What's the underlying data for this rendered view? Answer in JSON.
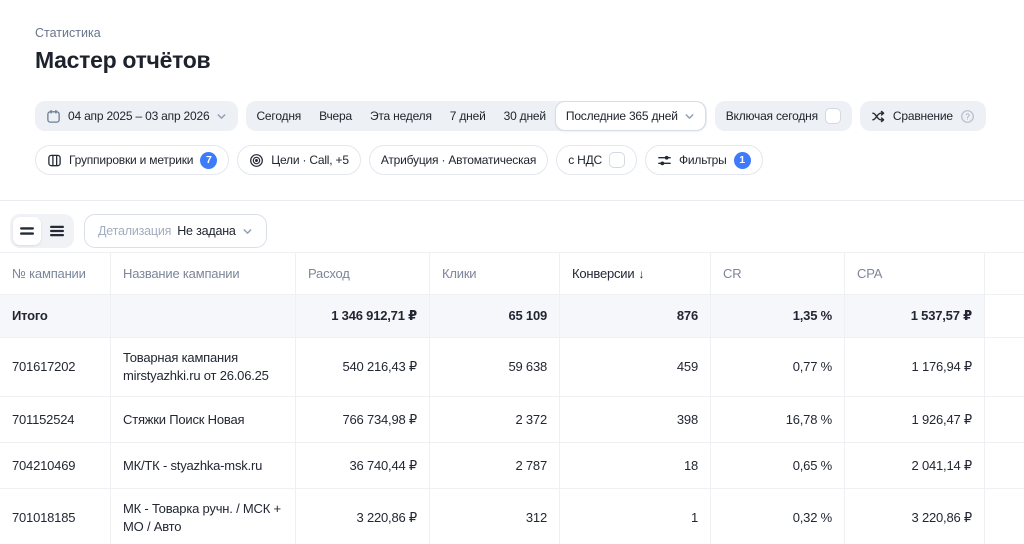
{
  "page": {
    "breadcrumb": "Статистика",
    "title": "Мастер отчётов"
  },
  "filters": {
    "date_range": "04 апр 2025 – 03 апр 2026",
    "quick_ranges": [
      "Сегодня",
      "Вчера",
      "Эта неделя",
      "7 дней",
      "30 дней"
    ],
    "selected_range": "Последние 365 дней",
    "include_today_label": "Включая сегодня",
    "comparison_label": "Сравнение",
    "groupings_label": "Группировки и метрики",
    "groupings_badge": "7",
    "goals_label": "Цели · Call, +5",
    "attribution_label": "Атрибуция · Автоматическая",
    "vat_label": "с НДС",
    "filters_label": "Фильтры",
    "filters_badge": "1"
  },
  "toolbar": {
    "detalization_label": "Детализация",
    "detalization_value": "Не задана"
  },
  "table": {
    "columns": [
      "№ кампании",
      "Название кампании",
      "Расход",
      "Клики",
      "Конверсии",
      "CR",
      "CPA"
    ],
    "sort": {
      "column": "Конверсии",
      "direction": "desc"
    },
    "totals": {
      "label": "Итого",
      "cost": "1 346 912,71 ₽",
      "clicks": "65 109",
      "conversions": "876",
      "cr": "1,35 %",
      "cpa": "1 537,57 ₽"
    },
    "rows": [
      {
        "id": "701617202",
        "name": "Товарная кампания mirstyazhki.ru от 26.06.25",
        "cost": "540 216,43 ₽",
        "clicks": "59 638",
        "conversions": "459",
        "cr": "0,77 %",
        "cpa": "1 176,94 ₽"
      },
      {
        "id": "701152524",
        "name": "Стяжки Поиск Новая",
        "cost": "766 734,98 ₽",
        "clicks": "2 372",
        "conversions": "398",
        "cr": "16,78 %",
        "cpa": "1 926,47 ₽"
      },
      {
        "id": "704210469",
        "name": "МК/ТК - styazhka-msk.ru",
        "cost": "36 740,44 ₽",
        "clicks": "2 787",
        "conversions": "18",
        "cr": "0,65 %",
        "cpa": "2 041,14 ₽"
      },
      {
        "id": "701018185",
        "name": "МК - Товарка ручн. / МСК + МО / Авто",
        "cost": "3 220,86 ₽",
        "clicks": "312",
        "conversions": "1",
        "cr": "0,32 %",
        "cpa": "3 220,86 ₽"
      }
    ]
  },
  "colors": {
    "accent_blue": "#3e7bfa",
    "pill_grey": "#edf0f5",
    "text_dark": "#20252e",
    "text_muted": "#7c8699",
    "totals_row_bg": "#f6f7fa",
    "table_border": "#eef0f3"
  }
}
